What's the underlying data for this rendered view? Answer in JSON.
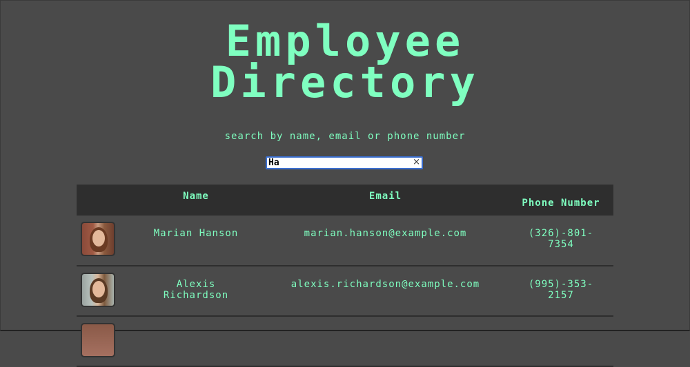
{
  "header": {
    "title_line1": "Employee",
    "title_line2": "Directory",
    "subtitle": "search by name, email or phone number"
  },
  "search": {
    "value": "Ha",
    "clear_glyph": "×"
  },
  "table": {
    "columns": [
      "",
      "Name",
      "Email",
      "Phone Number"
    ],
    "rows": [
      {
        "avatar": "photo-woman-brick-background",
        "name": "Marian Hanson",
        "email": "marian.hanson@example.com",
        "phone_line1": "(326)-801-",
        "phone_line2": "7354"
      },
      {
        "avatar": "photo-woman-smiling",
        "name_line1": "Alexis",
        "name_line2": "Richardson",
        "email": "alexis.richardson@example.com",
        "phone_line1": "(995)-353-",
        "phone_line2": "2157"
      }
    ]
  },
  "colors": {
    "background": "#4a4a4a",
    "header_row": "#2e2e2e",
    "accent_text": "#7fffc0",
    "search_border": "#3b6fd0"
  }
}
